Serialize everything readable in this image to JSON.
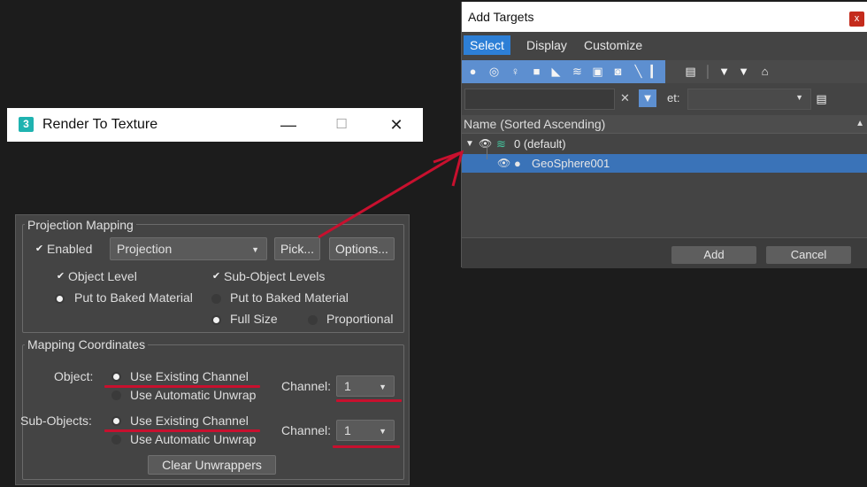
{
  "render_to_texture": {
    "title": "Render To Texture",
    "icon_text": "3",
    "window_buttons": {
      "minimize": "—",
      "maximize": "☐",
      "close": "✕"
    },
    "projection_mapping": {
      "group_label": "Projection Mapping",
      "enabled_label": "Enabled",
      "enabled_checked": true,
      "projection_value": "Projection",
      "pick_button": "Pick...",
      "options_button": "Options...",
      "object_level_label": "Object Level",
      "object_level_checked": true,
      "sub_object_levels_label": "Sub-Object Levels",
      "sub_object_levels_checked": true,
      "put_to_baked_left": "Put to Baked Material",
      "put_to_baked_right": "Put to Baked Material",
      "full_size": "Full Size",
      "proportional": "Proportional"
    },
    "mapping_coordinates": {
      "group_label": "Mapping Coordinates",
      "object_label": "Object:",
      "sub_objects_label": "Sub-Objects:",
      "use_existing_channel": "Use Existing Channel",
      "use_automatic_unwrap": "Use Automatic Unwrap",
      "channel_label": "Channel:",
      "object_channel_value": "1",
      "sub_object_channel_value": "1",
      "clear_unwrappers_button": "Clear Unwrappers"
    }
  },
  "add_targets": {
    "title": "Add Targets",
    "close_glyph": "x",
    "tabs": [
      "Select",
      "Display",
      "Customize"
    ],
    "active_tab": "Select",
    "filter_label": "et:",
    "column_header": "Name (Sorted Ascending)",
    "tree": [
      {
        "label": "0 (default)",
        "level": 0,
        "selected": false
      },
      {
        "label": "GeoSphere001",
        "level": 1,
        "selected": true
      }
    ],
    "add_button": "Add",
    "cancel_button": "Cancel"
  },
  "colors": {
    "accent": "#2d7fd6",
    "annotation": "#c8102e",
    "panel": "#444444"
  }
}
